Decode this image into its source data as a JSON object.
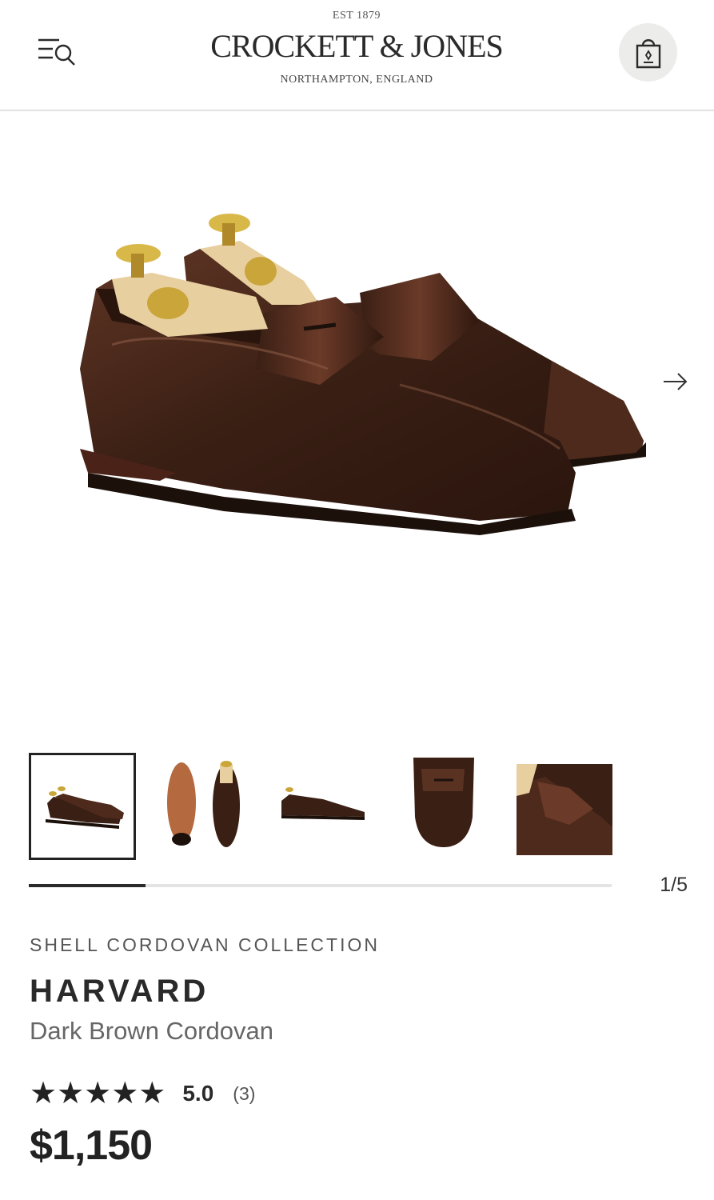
{
  "header": {
    "est": "EST 1879",
    "brand_name": "CROCKETT & JONES",
    "location": "NORTHAMPTON, ENGLAND"
  },
  "icons": {
    "menu": "menu-search-icon",
    "bag": "shopping-bag-icon",
    "next": "arrow-right-icon"
  },
  "gallery": {
    "thumbnails": [
      "Side pair view",
      "Sole and top view",
      "Single side view",
      "Top toe view",
      "Close-up detail"
    ],
    "active_index": 0,
    "counter": "1/5",
    "progress_fraction": 0.2
  },
  "product": {
    "collection": "SHELL CORDOVAN COLLECTION",
    "name": "HARVARD",
    "color": "Dark Brown Cordovan",
    "rating_stars": "★★★★★",
    "rating_value": "5.0",
    "review_count": "(3)",
    "price": "$1,150"
  },
  "colors": {
    "leather": "#3a1f14",
    "leather_highlight": "#6b3a28",
    "sole": "#2a1a14",
    "shoetree_wood": "#e8cf9f",
    "brass": "#c9a53a",
    "bag_button_bg": "#ececea"
  }
}
